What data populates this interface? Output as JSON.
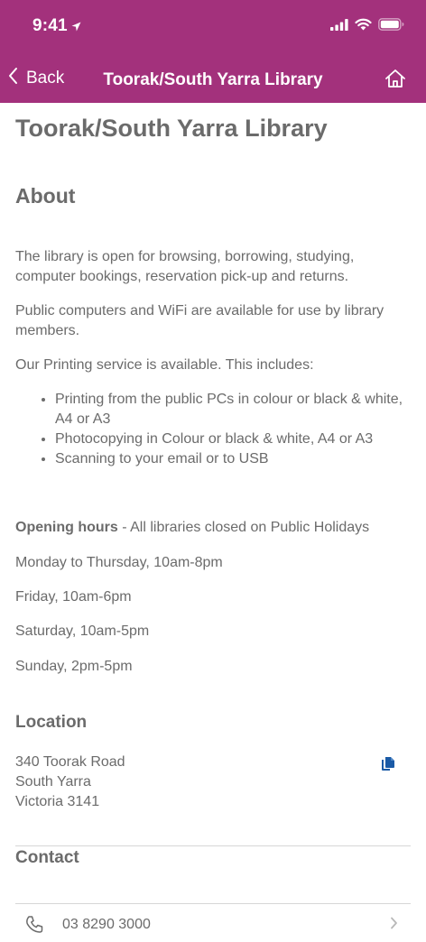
{
  "status_bar": {
    "time": "9:41"
  },
  "nav": {
    "back_label": "Back",
    "title": "Toorak/South Yarra Library"
  },
  "page": {
    "title": "Toorak/South Yarra Library"
  },
  "about": {
    "heading": "About",
    "paragraphs": [
      "The library is open for browsing, borrowing, studying, computer bookings, reservation pick-up and returns.",
      "Public computers and WiFi are available for use by library members.",
      "Our Printing service is available. This includes:"
    ],
    "bullets": [
      "Printing from the public PCs in colour or black & white, A4 or A3",
      "Photocopying in Colour or black & white, A4 or A3",
      "Scanning to your email or to USB"
    ]
  },
  "hours": {
    "label": "Opening hours",
    "note": " - All libraries closed on Public Holidays",
    "lines": [
      "Monday to Thursday, 10am-8pm",
      "Friday, 10am-6pm",
      "Saturday, 10am-5pm",
      "Sunday, 2pm-5pm"
    ]
  },
  "location": {
    "heading": "Location",
    "address_lines": [
      "340 Toorak Road",
      "South Yarra",
      "Victoria 3141"
    ]
  },
  "contact": {
    "heading": "Contact",
    "phone": "03 8290 3000"
  },
  "colors": {
    "header_bg": "#a3317c",
    "text": "#6b6b6b",
    "accent_icon": "#1a5aa6"
  },
  "icons": {
    "location_arrow": "location-arrow-icon",
    "signal": "signal-icon",
    "wifi": "wifi-icon",
    "battery": "battery-icon",
    "back": "chevron-left-icon",
    "home": "home-icon",
    "copy": "copy-icon",
    "phone": "phone-icon",
    "chevron": "chevron-right-icon"
  }
}
